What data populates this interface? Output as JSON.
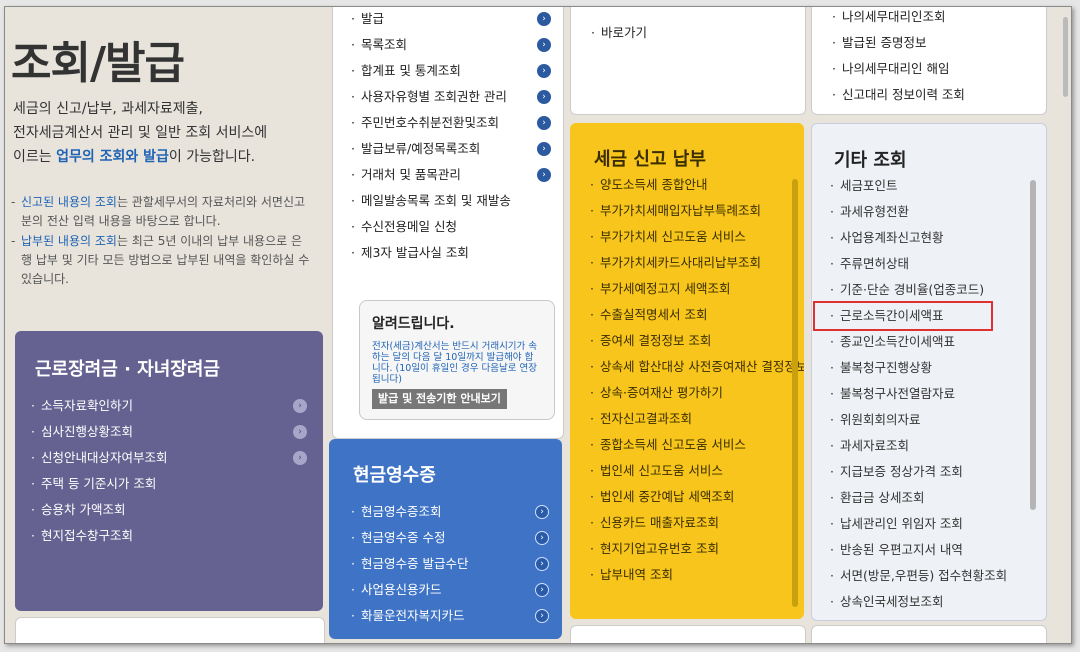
{
  "intro": {
    "title": "조회/발급",
    "desc_line1": "세금의 신고/납부, 과세자료제출,",
    "desc_line2": "전자세금계산서 관리 및 일반 조회 서비스에",
    "desc_line3_pre": "이르는 ",
    "desc_line3_hl": "업무의 조회와 발급",
    "desc_line3_post": "이 가능합니다.",
    "note1_u": "신고된 내용의 조회",
    "note1_rest": "는 관할세무서의 자료처리와 서면신고분의 전산 입력 내용을 바탕으로 합니다.",
    "note2_u": "납부된 내용의 조회",
    "note2_rest": "는 최근 5년 이내의 납부 내용으로 은행 납부 및 기타 모든 방법으로 납부된 내역을 확인하실 수 있습니다."
  },
  "col2_top": {
    "items": [
      "발급",
      "목록조회",
      "합계표 및 통계조회",
      "사용자유형별 조회권한 관리",
      "주민번호수취분전환및조회",
      "발급보류/예정목록조회",
      "거래처 및 품목관리",
      "메일발송목록 조회 및 재발송",
      "수신전용메일 신청",
      "제3자 발급사실 조회"
    ]
  },
  "notice": {
    "title": "알려드립니다.",
    "text": "전자(세금)계산서는 반드시 거래시기가 속하는 달의 다음 달 10일까지 발급해야 합니다. (10일이 휴일인 경우 다음날로 연장됩니다)",
    "button": "발급 및 전송기한 안내보기"
  },
  "purple": {
    "title": "근로장려금 · 자녀장려금",
    "items": [
      "소득자료확인하기",
      "심사진행상황조회",
      "신청안내대상자여부조회",
      "주택 등 기준시가 조회",
      "승용차 가액조회",
      "현지접수창구조회"
    ]
  },
  "blue": {
    "title": "현금영수증",
    "items": [
      "현금영수증조회",
      "현금영수증 수정",
      "현금영수증 발급수단",
      "사업용신용카드",
      "화물운전자복지카드"
    ]
  },
  "col3_top": {
    "items": [
      "바로가기"
    ]
  },
  "yellow": {
    "title": "세금 신고 납부",
    "items": [
      "양도소득세 종합안내",
      "부가가치세매입자납부특례조회",
      "부가가치세 신고도움 서비스",
      "부가가치세카드사대리납부조회",
      "부가세예정고지 세액조회",
      "수출실적명세서 조회",
      "증여세 결정정보 조회",
      "상속세 합산대상 사전증여재산 결정정보 조회",
      "상속·증여재산 평가하기",
      "전자신고결과조회",
      "종합소득세 신고도움 서비스",
      "법인세 신고도움 서비스",
      "법인세 중간예납 세액조회",
      "신용카드 매출자료조회",
      "현지기업고유번호 조회",
      "납부내역 조회"
    ]
  },
  "col4_top": {
    "items": [
      "나의세무대리인조회",
      "발급된 증명정보",
      "나의세무대리인 해임",
      "신고대리 정보이력 조회"
    ]
  },
  "grey": {
    "title": "기타 조회",
    "items": [
      "세금포인트",
      "과세유형전환",
      "사업용계좌신고현황",
      "주류면허상태",
      "기준·단순 경비율(업종코드)",
      "근로소득간이세액표",
      "종교인소득간이세액표",
      "불복청구진행상황",
      "불복청구사전열람자료",
      "위원회회의자료",
      "과세자료조회",
      "지급보증 정상가격 조회",
      "환급금 상세조회",
      "납세관리인 위임자 조회",
      "반송된 우편고지서 내역",
      "서면(방문,우편등) 접수현황조회",
      "상속인국세정보조회"
    ]
  }
}
